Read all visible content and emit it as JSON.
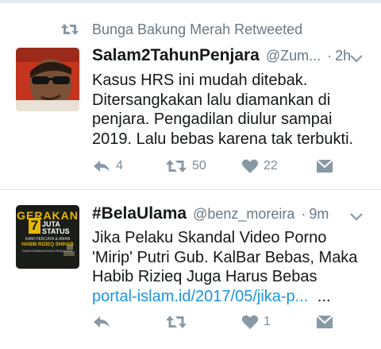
{
  "tweets": [
    {
      "context": "Bunga Bakung Merah Retweeted",
      "name": "Salam2TahunPenjara",
      "handle": "@Zum...",
      "dot": "·",
      "time": "2h",
      "lines": [
        "Kasus HRS ini mudah ditebak.",
        "Ditersangkakan lalu diamankan di",
        "penjara. Pengadilan diulur sampai",
        "2019. Lalu bebas karena tak terbukti."
      ],
      "reply_count": "4",
      "retweet_count": "50",
      "like_count": "22"
    },
    {
      "name": "#BelaUlama",
      "handle": "@benz_moreira",
      "dot": "·",
      "time": "9m",
      "lines": [
        "Jika Pelaku Skandal Video Porno",
        "'Mirip' Putri Gub. KalBar Bebas, Maka",
        "Habib Rizieq Juga Harus Bebas"
      ],
      "link": "portal-islam.id/2017/05/jika-p...",
      "ellipsis": "...",
      "reply_count": "",
      "retweet_count": "",
      "like_count": "1",
      "avatar_text": {
        "l1": "GERAKAN",
        "l2": "7",
        "l3": "JUTA",
        "l4": "STATUS",
        "l5": "KAMI PERCAYA & AMAN",
        "l6": "HABIB RIZIEQ SHIHAB",
        "l7": "DARI KRIMINALISASI PENGUASA"
      }
    }
  ],
  "colors": {
    "muted": "#6a7884",
    "link": "#1b95e0",
    "icon": "#8899a6"
  }
}
